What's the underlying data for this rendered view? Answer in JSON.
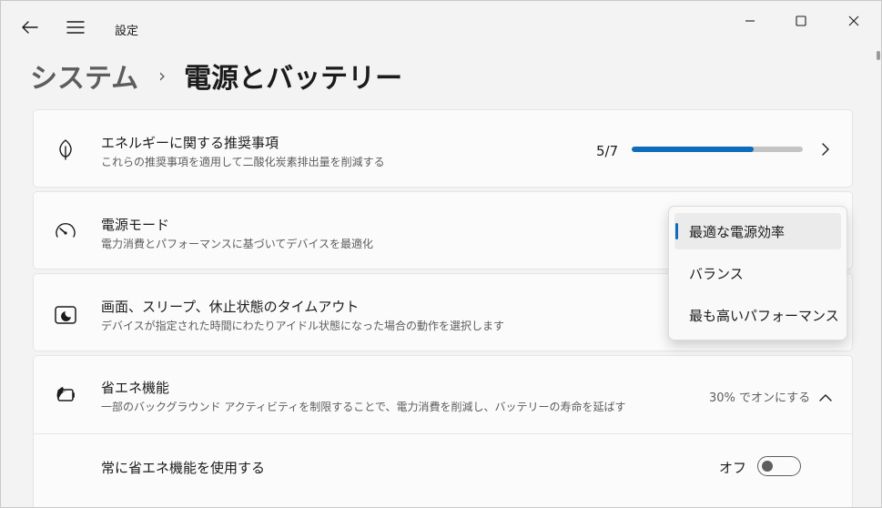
{
  "app": {
    "title": "設定"
  },
  "breadcrumb": {
    "parent": "システム",
    "separator": "›",
    "current": "電源とバッテリー"
  },
  "energy": {
    "title": "エネルギーに関する推奨事項",
    "subtitle": "これらの推奨事項を適用して二酸化炭素排出量を削減する",
    "progress_text": "5/7",
    "progress_fraction": 0.714,
    "icon": "leaf-icon"
  },
  "power_mode": {
    "title": "電源モード",
    "subtitle": "電力消費とパフォーマンスに基づいてデバイスを最適化",
    "icon": "gauge-icon",
    "options": [
      {
        "label": "最適な電源効率",
        "selected": true
      },
      {
        "label": "バランス",
        "selected": false
      },
      {
        "label": "最も高いパフォーマンス",
        "selected": false
      }
    ]
  },
  "screen_sleep": {
    "title": "画面、スリープ、休止状態のタイムアウト",
    "subtitle": "デバイスが指定された時間にわたりアイドル状態になった場合の動作を選択します",
    "icon": "screen-sleep-icon"
  },
  "battery_saver": {
    "title": "省エネ機能",
    "subtitle": "一部のバックグラウンド アクティビティを制限することで、電力消費を削減し、バッテリーの寿命を延ばす",
    "status": "30% でオンにする",
    "icon": "battery-saver-icon",
    "always_on_label": "常に省エネ機能を使用する",
    "toggle_state": "オフ"
  },
  "colors": {
    "accent": "#0f6cbd",
    "track": "#c4c4c4",
    "window_bg": "#f3f3f3",
    "card_bg": "#fbfbfb"
  }
}
